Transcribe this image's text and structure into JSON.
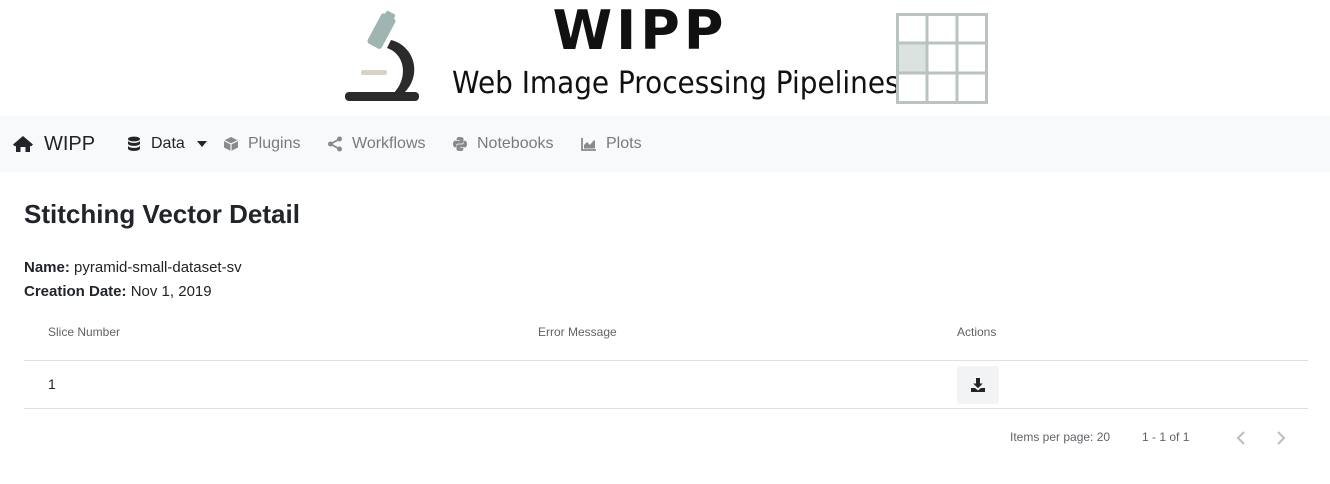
{
  "banner": {
    "title": "WIPP",
    "subtitle": "Web Image Processing Pipelines"
  },
  "navbar": {
    "brand": "WIPP",
    "items": [
      {
        "label": "Data",
        "icon": "database-icon",
        "active": true
      },
      {
        "label": "Plugins",
        "icon": "cube-icon"
      },
      {
        "label": "Workflows",
        "icon": "share-icon"
      },
      {
        "label": "Notebooks",
        "icon": "python-icon"
      },
      {
        "label": "Plots",
        "icon": "area-chart-icon"
      }
    ]
  },
  "page": {
    "title": "Stitching Vector Detail",
    "name_label": "Name:",
    "name_value": "pyramid-small-dataset-sv",
    "date_label": "Creation Date:",
    "date_value": "Nov 1, 2019"
  },
  "table": {
    "columns": [
      "Slice Number",
      "Error Message",
      "Actions"
    ],
    "rows": [
      {
        "slice": "1",
        "error": "",
        "action": "download-icon"
      }
    ]
  },
  "paginator": {
    "items_per_page_label": "Items per page:",
    "items_per_page_value": "20",
    "range": "1 - 1 of 1"
  },
  "colors": {
    "navbar_bg": "#f8f9fa",
    "text": "#212529",
    "muted": "#7a7a7a",
    "microscope_accent": "#9fb5b2"
  }
}
